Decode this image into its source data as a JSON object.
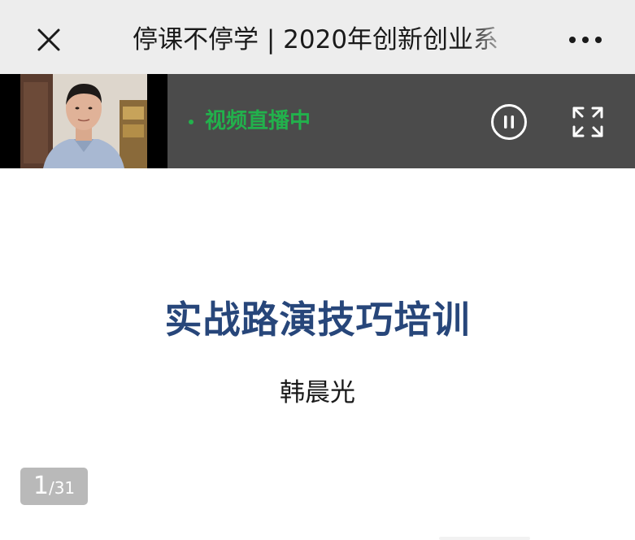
{
  "nav": {
    "title": "停课不停学 | 2020年创新创业系",
    "close_icon": "close-icon",
    "more_icon": "more-icon"
  },
  "live": {
    "status_label": "视频直播中",
    "status_color": "#22b14c",
    "pause_icon": "pause-icon",
    "fullscreen_icon": "fullscreen-icon"
  },
  "slide": {
    "title": "实战路演技巧培训",
    "title_color": "#27467a",
    "author": "韩晨光",
    "page": {
      "current": "1",
      "separator": "/",
      "total": "31"
    }
  }
}
